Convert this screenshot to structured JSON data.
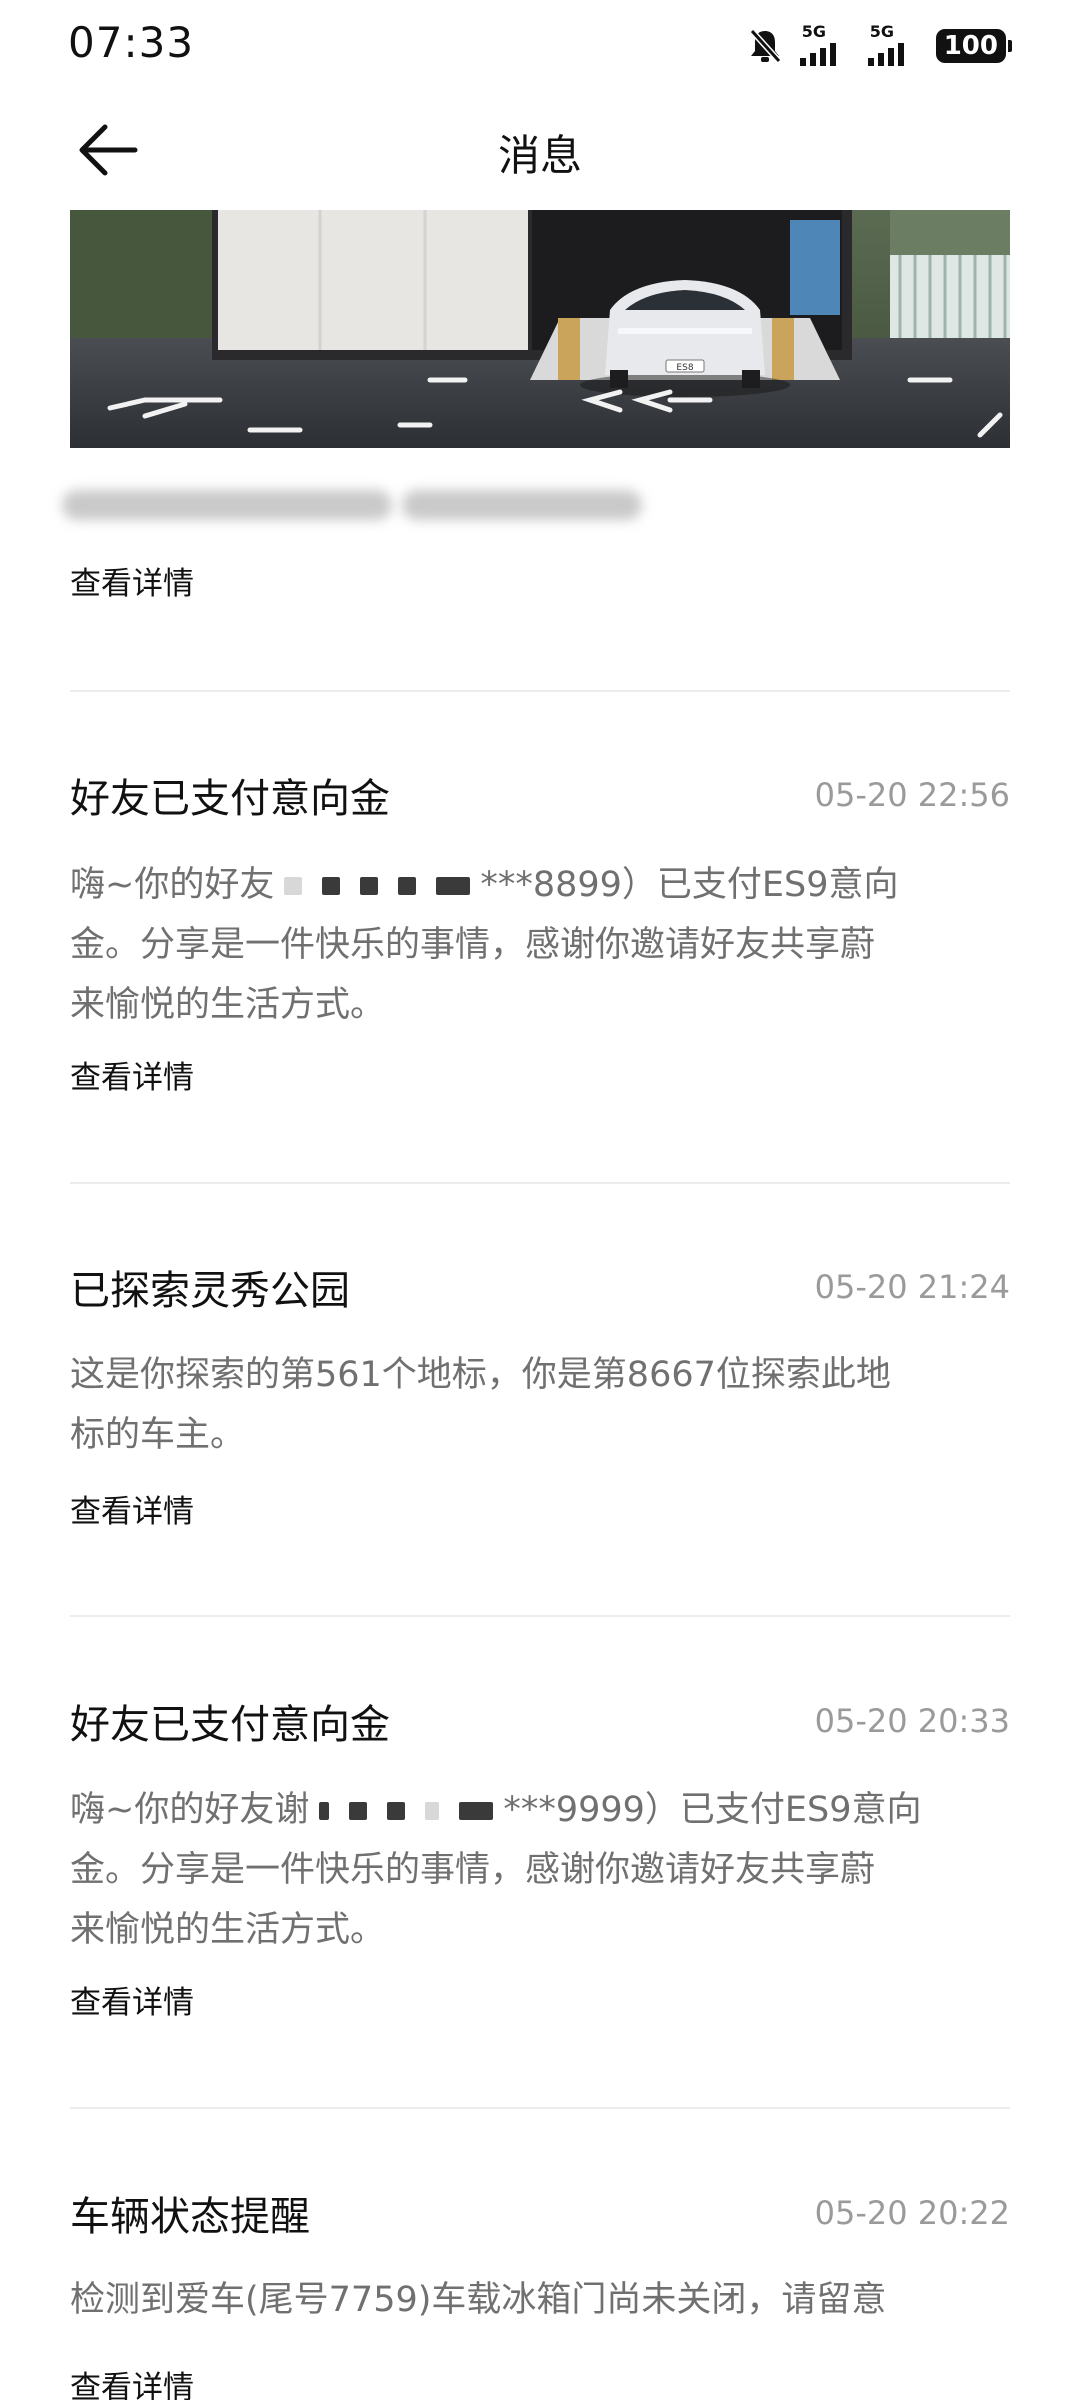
{
  "status_bar": {
    "time": "07:33",
    "network_1": "5G",
    "network_2": "5G",
    "battery": "100",
    "icons": [
      "bell-off-icon",
      "signal-icon",
      "battery-icon"
    ]
  },
  "nav": {
    "title": "消息",
    "back_icon": "arrow-left-icon"
  },
  "hero": {
    "car_badge": "ES8",
    "detail_label": "查看详情"
  },
  "messages": [
    {
      "title": "好友已支付意向金",
      "time": "05-20 22:56",
      "line1_prefix": "嗨~你的好友",
      "line1_suffix": "***8899）已支付ES9意向",
      "line2": "金。分享是一件快乐的事情，感谢你邀请好友共享蔚",
      "line3": "来愉悦的生活方式。",
      "detail_label": "查看详情"
    },
    {
      "title": "已探索灵秀公园",
      "time": "05-20 21:24",
      "line1": "这是你探索的第561个地标，你是第8667位探索此地",
      "line2": "标的车主。",
      "detail_label": "查看详情"
    },
    {
      "title": "好友已支付意向金",
      "time": "05-20 20:33",
      "line1_prefix": "嗨~你的好友谢",
      "line1_suffix": "***9999）已支付ES9意向",
      "line2": "金。分享是一件快乐的事情，感谢你邀请好友共享蔚",
      "line3": "来愉悦的生活方式。",
      "detail_label": "查看详情"
    },
    {
      "title": "车辆状态提醒",
      "time": "05-20 20:22",
      "line1": "检测到爱车(尾号7759)车载冰箱门尚未关闭，请留意",
      "detail_label": "查看详情"
    }
  ],
  "colors": {
    "text_primary": "#1a1a1a",
    "text_secondary": "#707070",
    "text_time": "#9a9a9a",
    "divider": "#ececec"
  }
}
